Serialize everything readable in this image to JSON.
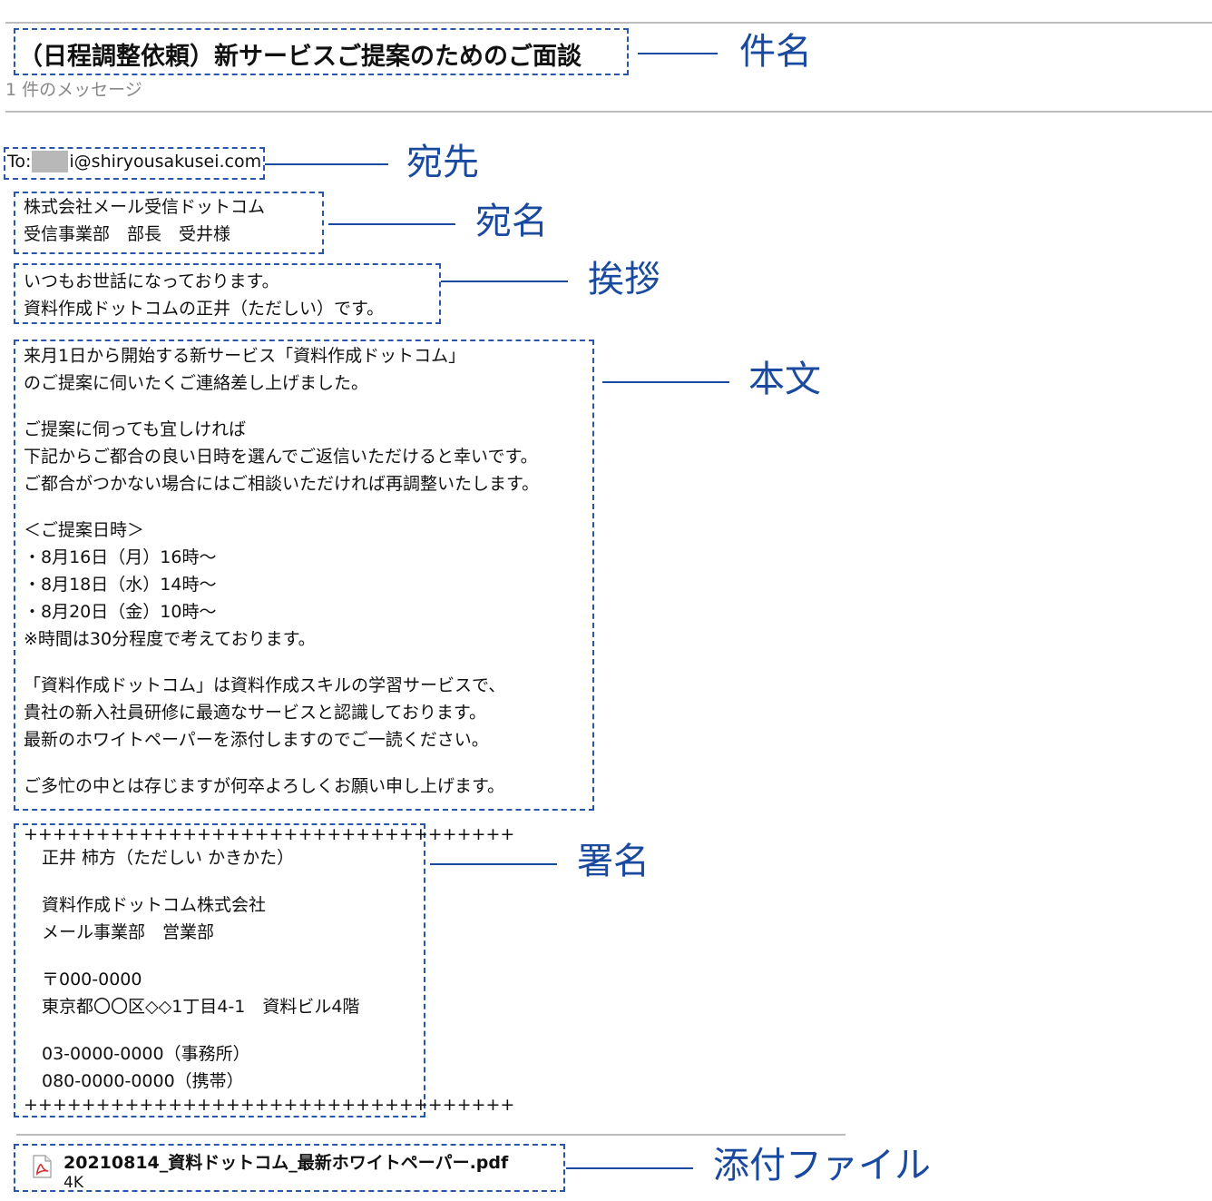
{
  "email": {
    "subject": "（日程調整依頼）新サービスご提案のためのご面談",
    "message_count": "1 件のメッセージ",
    "to_label": "To:",
    "to_address": "i@shiryousakusei.com",
    "addressee": [
      "株式会社メール受信ドットコム",
      "受信事業部　部長　受井様"
    ],
    "greeting": [
      "いつもお世話になっております。",
      "資料作成ドットコムの正井（ただしい）です。"
    ],
    "body_paragraphs": [
      [
        "来月1日から開始する新サービス「資料作成ドットコム」",
        "のご提案に伺いたくご連絡差し上げました。"
      ],
      [
        "ご提案に伺っても宜しければ",
        "下記からご都合の良い日時を選んでご返信いただけると幸いです。",
        "ご都合がつかない場合にはご相談いただければ再調整いたします。"
      ],
      [
        "＜ご提案日時＞",
        "・8月16日（月）16時〜",
        "・8月18日（水）14時〜",
        "・8月20日（金）10時〜",
        "※時間は30分程度で考えております。"
      ],
      [
        "「資料作成ドットコム」は資料作成スキルの学習サービスで、",
        "貴社の新入社員研修に最適なサービスと認識しております。",
        "最新のホワイトペーパーを添付しますのでご一読ください。"
      ],
      [
        "ご多忙の中とは存じますが何卒よろしくお願い申し上げます。"
      ]
    ],
    "signature": {
      "border": "++++++++++++++++++++++++++++++++++",
      "name": "正井 柿方（ただしい かきかた）",
      "company": [
        "資料作成ドットコム株式会社",
        "メール事業部　営業部"
      ],
      "address": [
        "〒000-0000",
        "東京都〇〇区◇◇1丁目4-1　資料ビル4階"
      ],
      "phones": [
        "03-0000-0000（事務所）",
        "080-0000-0000（携帯）"
      ]
    },
    "attachment": {
      "filename": "20210814_資料ドットコム_最新ホワイトペーパー.pdf",
      "size": "4K",
      "icon": "pdf-file-icon"
    }
  },
  "annotations": {
    "subject": "件名",
    "to": "宛先",
    "addressee": "宛名",
    "greeting": "挨拶",
    "body": "本文",
    "signature": "署名",
    "attachment": "添付ファイル"
  },
  "colors": {
    "annotation": "#1a4aa0",
    "dashed_border": "#2a56a8",
    "divider": "#bdbdbd",
    "muted_text": "#888888"
  }
}
